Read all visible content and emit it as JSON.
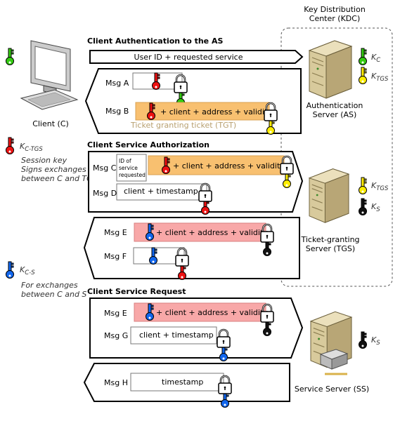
{
  "kdc": {
    "line1": "Key Distribution",
    "line2": "Center (KDC)"
  },
  "client": {
    "label": "Client (C)"
  },
  "as": {
    "line1": "Authentication",
    "line2": "Server (AS)"
  },
  "tgs": {
    "line1": "Ticket-granting",
    "line2": "Server (TGS)"
  },
  "ss": {
    "label": "Service Server (SS)"
  },
  "keys": {
    "kc": {
      "main": "K",
      "sub": "C",
      "color": "#33cc11"
    },
    "ktgs": {
      "main": "K",
      "sub": "TGS",
      "color": "#ffee00"
    },
    "ks": {
      "main": "K",
      "sub": "S",
      "color": "#111111"
    },
    "kctgs": {
      "main": "K",
      "sub": "C-TGS",
      "color": "#ee1111",
      "desc1": "Session key",
      "desc2": "Signs exchanges",
      "desc3": "between C and TGS"
    },
    "kcs": {
      "main": "K",
      "sub": "C-S",
      "color": "#1166ee",
      "desc1": "For exchanges",
      "desc2": "between C and S"
    }
  },
  "colors": {
    "tgt": "#f8c070",
    "service_ticket": "#f8a8a8",
    "tgt_label": "#b8a070"
  },
  "sections": {
    "auth": {
      "title": "Client Authentication to the AS",
      "request": "User ID + requested service",
      "msg_a": "Msg A",
      "msg_b": "Msg B",
      "msg_b_text": "+ client + address + validity",
      "tgt_label": "Ticket granting ticket (TGT)"
    },
    "authz": {
      "title": "Client Service Authorization",
      "msg_c": "Msg C",
      "id_line1": "ID of",
      "id_line2": "service",
      "id_line3": "requested",
      "msg_c_text": "+ client + address + validity",
      "msg_d": "Msg D",
      "msg_d_text": "client + timestamp",
      "msg_e": "Msg E",
      "msg_e_text": "+ client + address + validity",
      "msg_f": "Msg F"
    },
    "request": {
      "title": "Client Service Request",
      "msg_e": "Msg E",
      "msg_e_text": "+ client + address + validity",
      "msg_g": "Msg G",
      "msg_g_text": "client + timestamp",
      "msg_h": "Msg H",
      "msg_h_text": "timestamp"
    }
  }
}
